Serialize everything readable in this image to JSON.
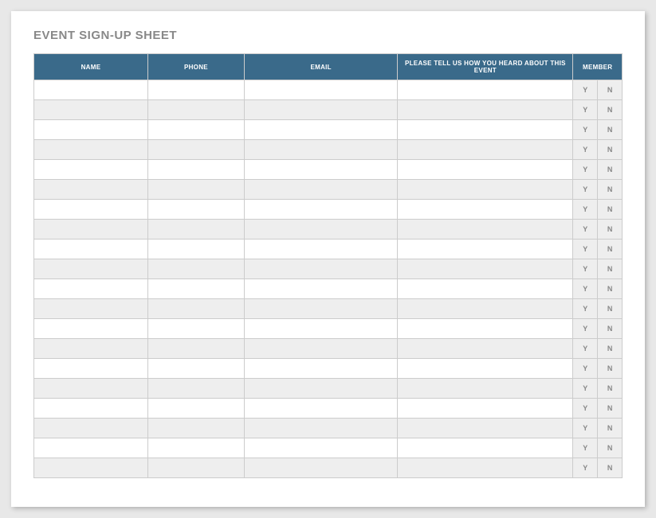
{
  "title": "EVENT SIGN-UP SHEET",
  "columns": {
    "name": "NAME",
    "phone": "PHONE",
    "email": "EMAIL",
    "heard": "PLEASE TELL US HOW YOU HEARD ABOUT THIS EVENT",
    "member": "MEMBER"
  },
  "yn": {
    "y": "Y",
    "n": "N"
  },
  "rows": [
    {
      "name": "",
      "phone": "",
      "email": "",
      "heard": ""
    },
    {
      "name": "",
      "phone": "",
      "email": "",
      "heard": ""
    },
    {
      "name": "",
      "phone": "",
      "email": "",
      "heard": ""
    },
    {
      "name": "",
      "phone": "",
      "email": "",
      "heard": ""
    },
    {
      "name": "",
      "phone": "",
      "email": "",
      "heard": ""
    },
    {
      "name": "",
      "phone": "",
      "email": "",
      "heard": ""
    },
    {
      "name": "",
      "phone": "",
      "email": "",
      "heard": ""
    },
    {
      "name": "",
      "phone": "",
      "email": "",
      "heard": ""
    },
    {
      "name": "",
      "phone": "",
      "email": "",
      "heard": ""
    },
    {
      "name": "",
      "phone": "",
      "email": "",
      "heard": ""
    },
    {
      "name": "",
      "phone": "",
      "email": "",
      "heard": ""
    },
    {
      "name": "",
      "phone": "",
      "email": "",
      "heard": ""
    },
    {
      "name": "",
      "phone": "",
      "email": "",
      "heard": ""
    },
    {
      "name": "",
      "phone": "",
      "email": "",
      "heard": ""
    },
    {
      "name": "",
      "phone": "",
      "email": "",
      "heard": ""
    },
    {
      "name": "",
      "phone": "",
      "email": "",
      "heard": ""
    },
    {
      "name": "",
      "phone": "",
      "email": "",
      "heard": ""
    },
    {
      "name": "",
      "phone": "",
      "email": "",
      "heard": ""
    },
    {
      "name": "",
      "phone": "",
      "email": "",
      "heard": ""
    },
    {
      "name": "",
      "phone": "",
      "email": "",
      "heard": ""
    }
  ]
}
